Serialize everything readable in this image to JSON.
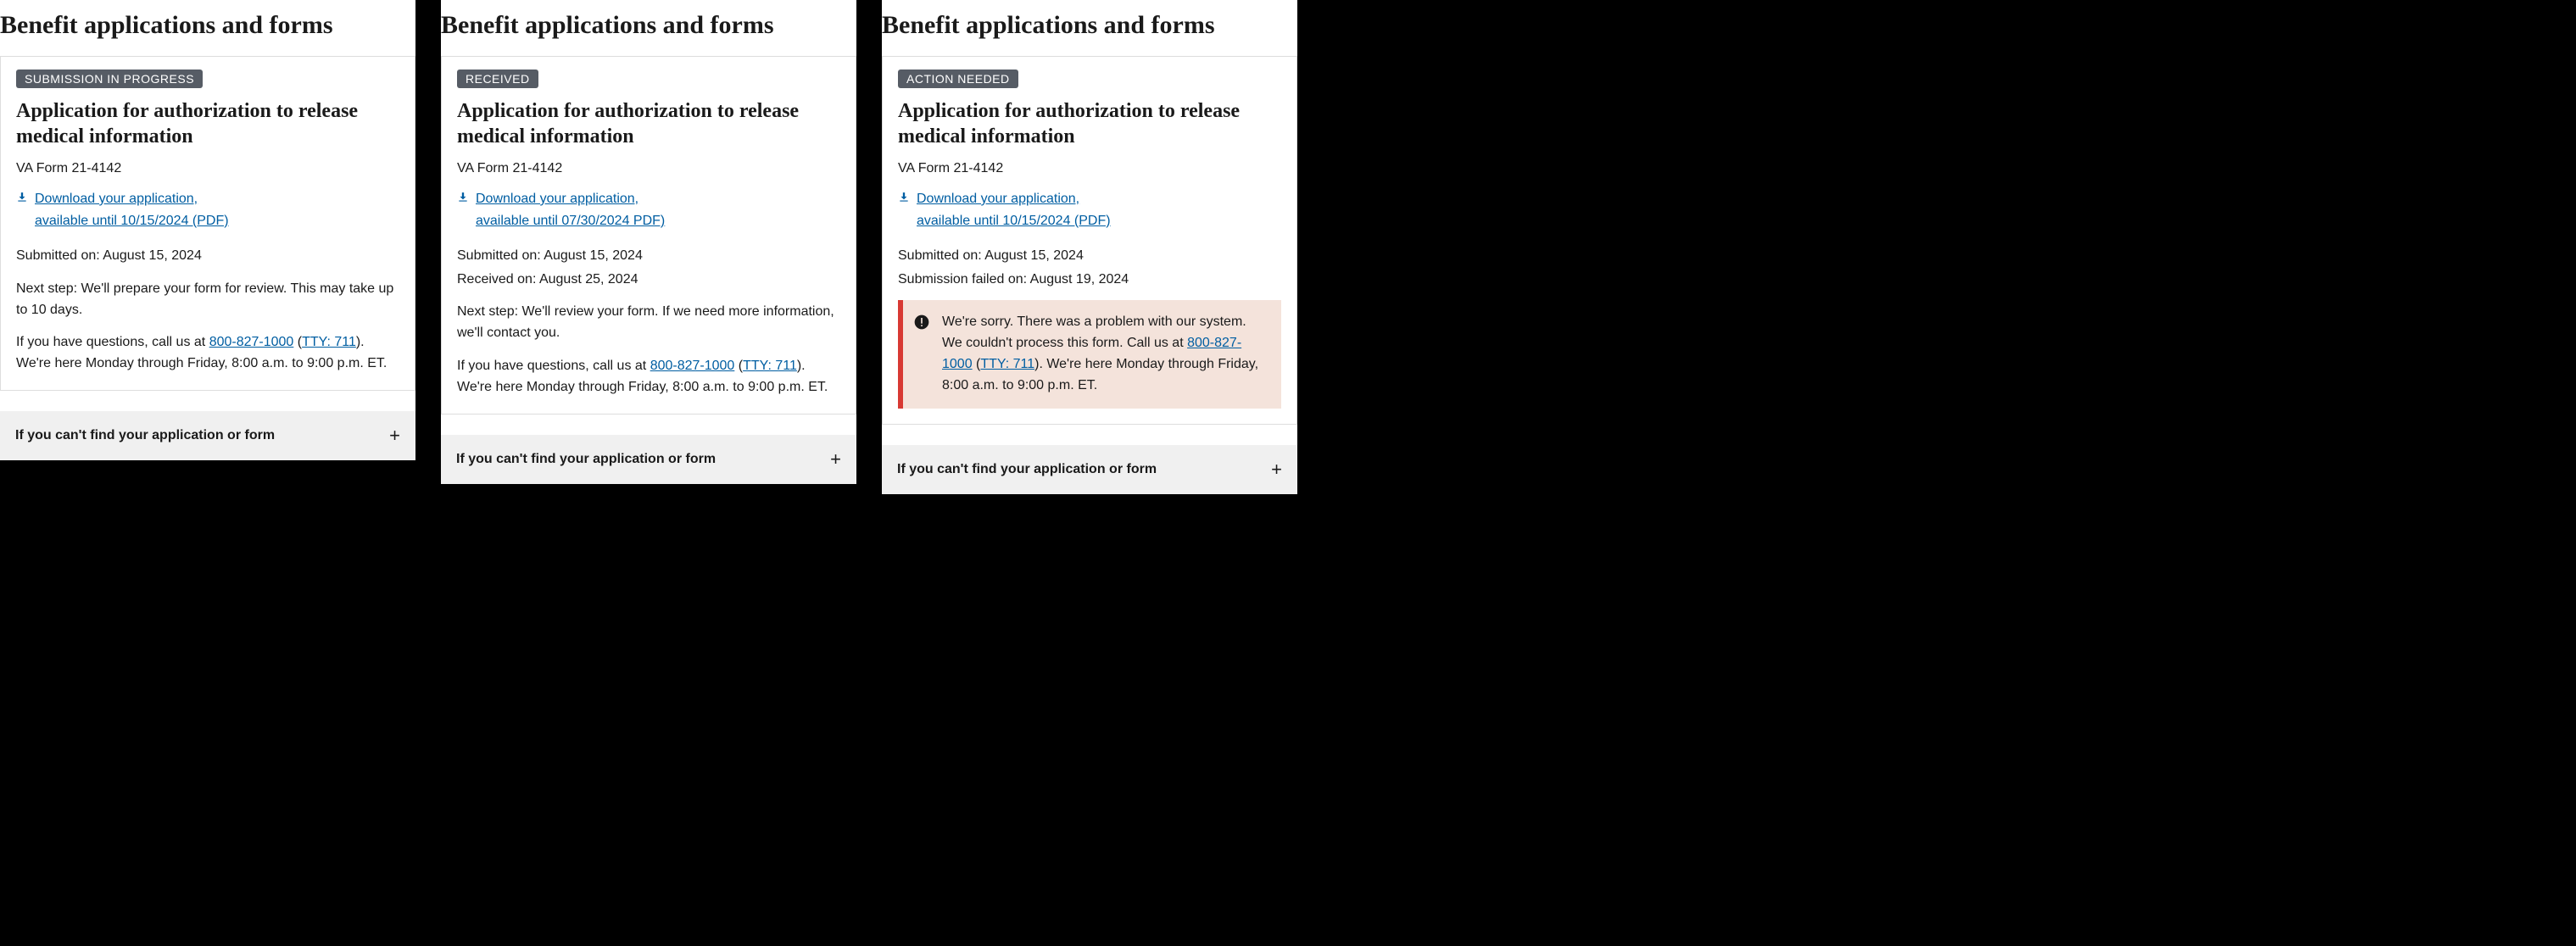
{
  "columns": [
    {
      "heading": "Benefit applications and forms",
      "status": "SUBMISSION IN PROGRESS",
      "title": "Application for authorization to release medical information",
      "form_number": "VA Form 21-4142",
      "download_line1": "Download your application,",
      "download_line2": "available until 10/15/2024 (PDF)",
      "date1_label": "Submitted on: ",
      "date1_value": "August 15, 2024",
      "date2_label": "",
      "date2_value": "",
      "next_step": "Next step: We'll prepare your form for review. This may take up to 10 days.",
      "questions_prefix": "If you have questions, call us at ",
      "phone": "800-827-1000",
      "tty_open": " (",
      "tty": "TTY: 711",
      "tty_close": ").",
      "questions_suffix": " We're here Monday through Friday, 8:00 a.m. to 9:00 p.m. ET.",
      "has_alert": false,
      "accordion": "If you can't find your application or form"
    },
    {
      "heading": "Benefit applications and forms",
      "status": "RECEIVED",
      "title": "Application for authorization to release medical information",
      "form_number": "VA Form 21-4142",
      "download_line1": "Download your application,",
      "download_line2": "available until 07/30/2024 PDF)",
      "date1_label": "Submitted on: ",
      "date1_value": "August 15, 2024",
      "date2_label": "Received on: ",
      "date2_value": "August 25, 2024",
      "next_step": "Next step: We'll review your form. If we need more information, we'll contact you.",
      "questions_prefix": "If you have questions, call us at ",
      "phone": "800-827-1000",
      "tty_open": " (",
      "tty": "TTY: 711",
      "tty_close": ").",
      "questions_suffix": " We're here Monday through Friday, 8:00 a.m. to 9:00 p.m. ET.",
      "has_alert": false,
      "accordion": "If you can't find your application or form"
    },
    {
      "heading": "Benefit applications and forms",
      "status": "ACTION NEEDED",
      "title": "Application for authorization to release medical information",
      "form_number": "VA Form 21-4142",
      "download_line1": "Download your application,",
      "download_line2": "available until 10/15/2024 (PDF)",
      "date1_label": "Submitted on: ",
      "date1_value": "August 15, 2024",
      "date2_label": "Submission failed on: ",
      "date2_value": "August 19, 2024",
      "next_step": "",
      "questions_prefix": "",
      "phone": "",
      "tty_open": "",
      "tty": "",
      "tty_close": "",
      "questions_suffix": "",
      "has_alert": true,
      "alert_prefix": "We're sorry. There was a problem with our system. We couldn't process this form. Call us at ",
      "alert_phone": "800-827-1000",
      "alert_tty_open": " (",
      "alert_tty": "TTY: 711",
      "alert_tty_close": ").",
      "alert_suffix": " We're here Monday through Friday, 8:00 a.m. to 9:00 p.m. ET.",
      "accordion": "If you can't find your application or form"
    }
  ]
}
